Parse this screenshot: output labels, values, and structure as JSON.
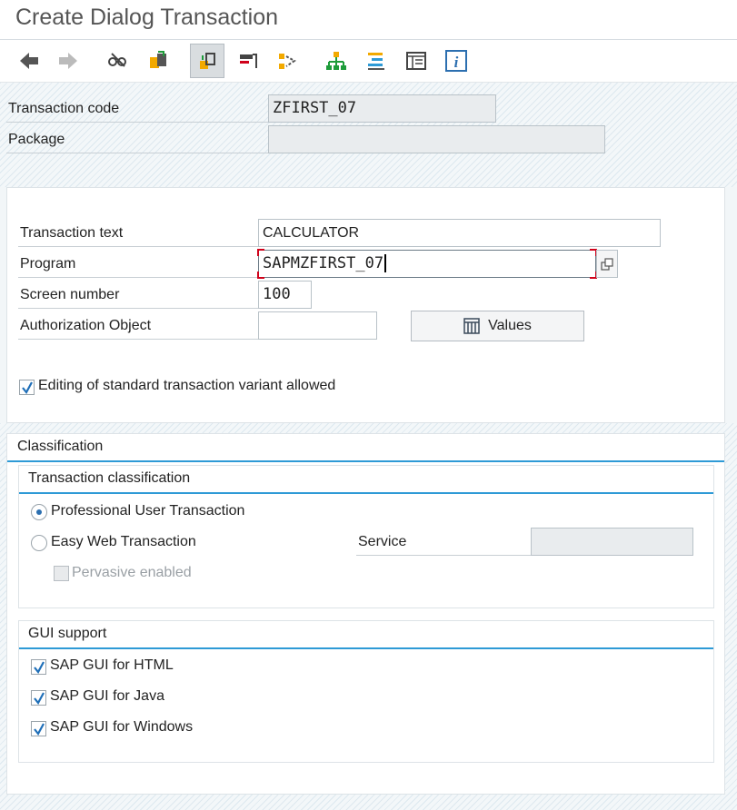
{
  "title": "Create Dialog Transaction",
  "toolbar": {
    "icons": [
      "back-arrow-icon",
      "forward-arrow-icon",
      "display-change-icon",
      "other-object-icon",
      "active-inactive-icon",
      "where-used-icon",
      "navigation-icon",
      "object-list-icon",
      "enhancement-icon",
      "layout-icon",
      "info-icon"
    ]
  },
  "header": {
    "tcode_label": "Transaction code",
    "tcode_value": "ZFIRST_07",
    "package_label": "Package",
    "package_value": ""
  },
  "main": {
    "text_label": "Transaction text",
    "text_value": "CALCULATOR",
    "program_label": "Program",
    "program_value": "SAPMZFIRST_07",
    "screen_label": "Screen number",
    "screen_value": "100",
    "auth_label": "Authorization Object",
    "auth_value": "",
    "values_button": "Values",
    "editing_label": "Editing of standard transaction variant allowed",
    "editing_checked": true
  },
  "classification": {
    "title": "Classification",
    "tx_class_title": "Transaction classification",
    "professional_label": "Professional User Transaction",
    "easyweb_label": "Easy Web Transaction",
    "selected": "professional",
    "service_label": "Service",
    "service_value": "",
    "pervasive_label": "Pervasive enabled",
    "gui_title": "GUI support",
    "gui_html": "SAP GUI for HTML",
    "gui_java": "SAP GUI for Java",
    "gui_windows": "SAP GUI for Windows"
  },
  "colors": {
    "accent": "#2e9ad6",
    "focus": "#d0021b",
    "check": "#1f6fb8"
  }
}
